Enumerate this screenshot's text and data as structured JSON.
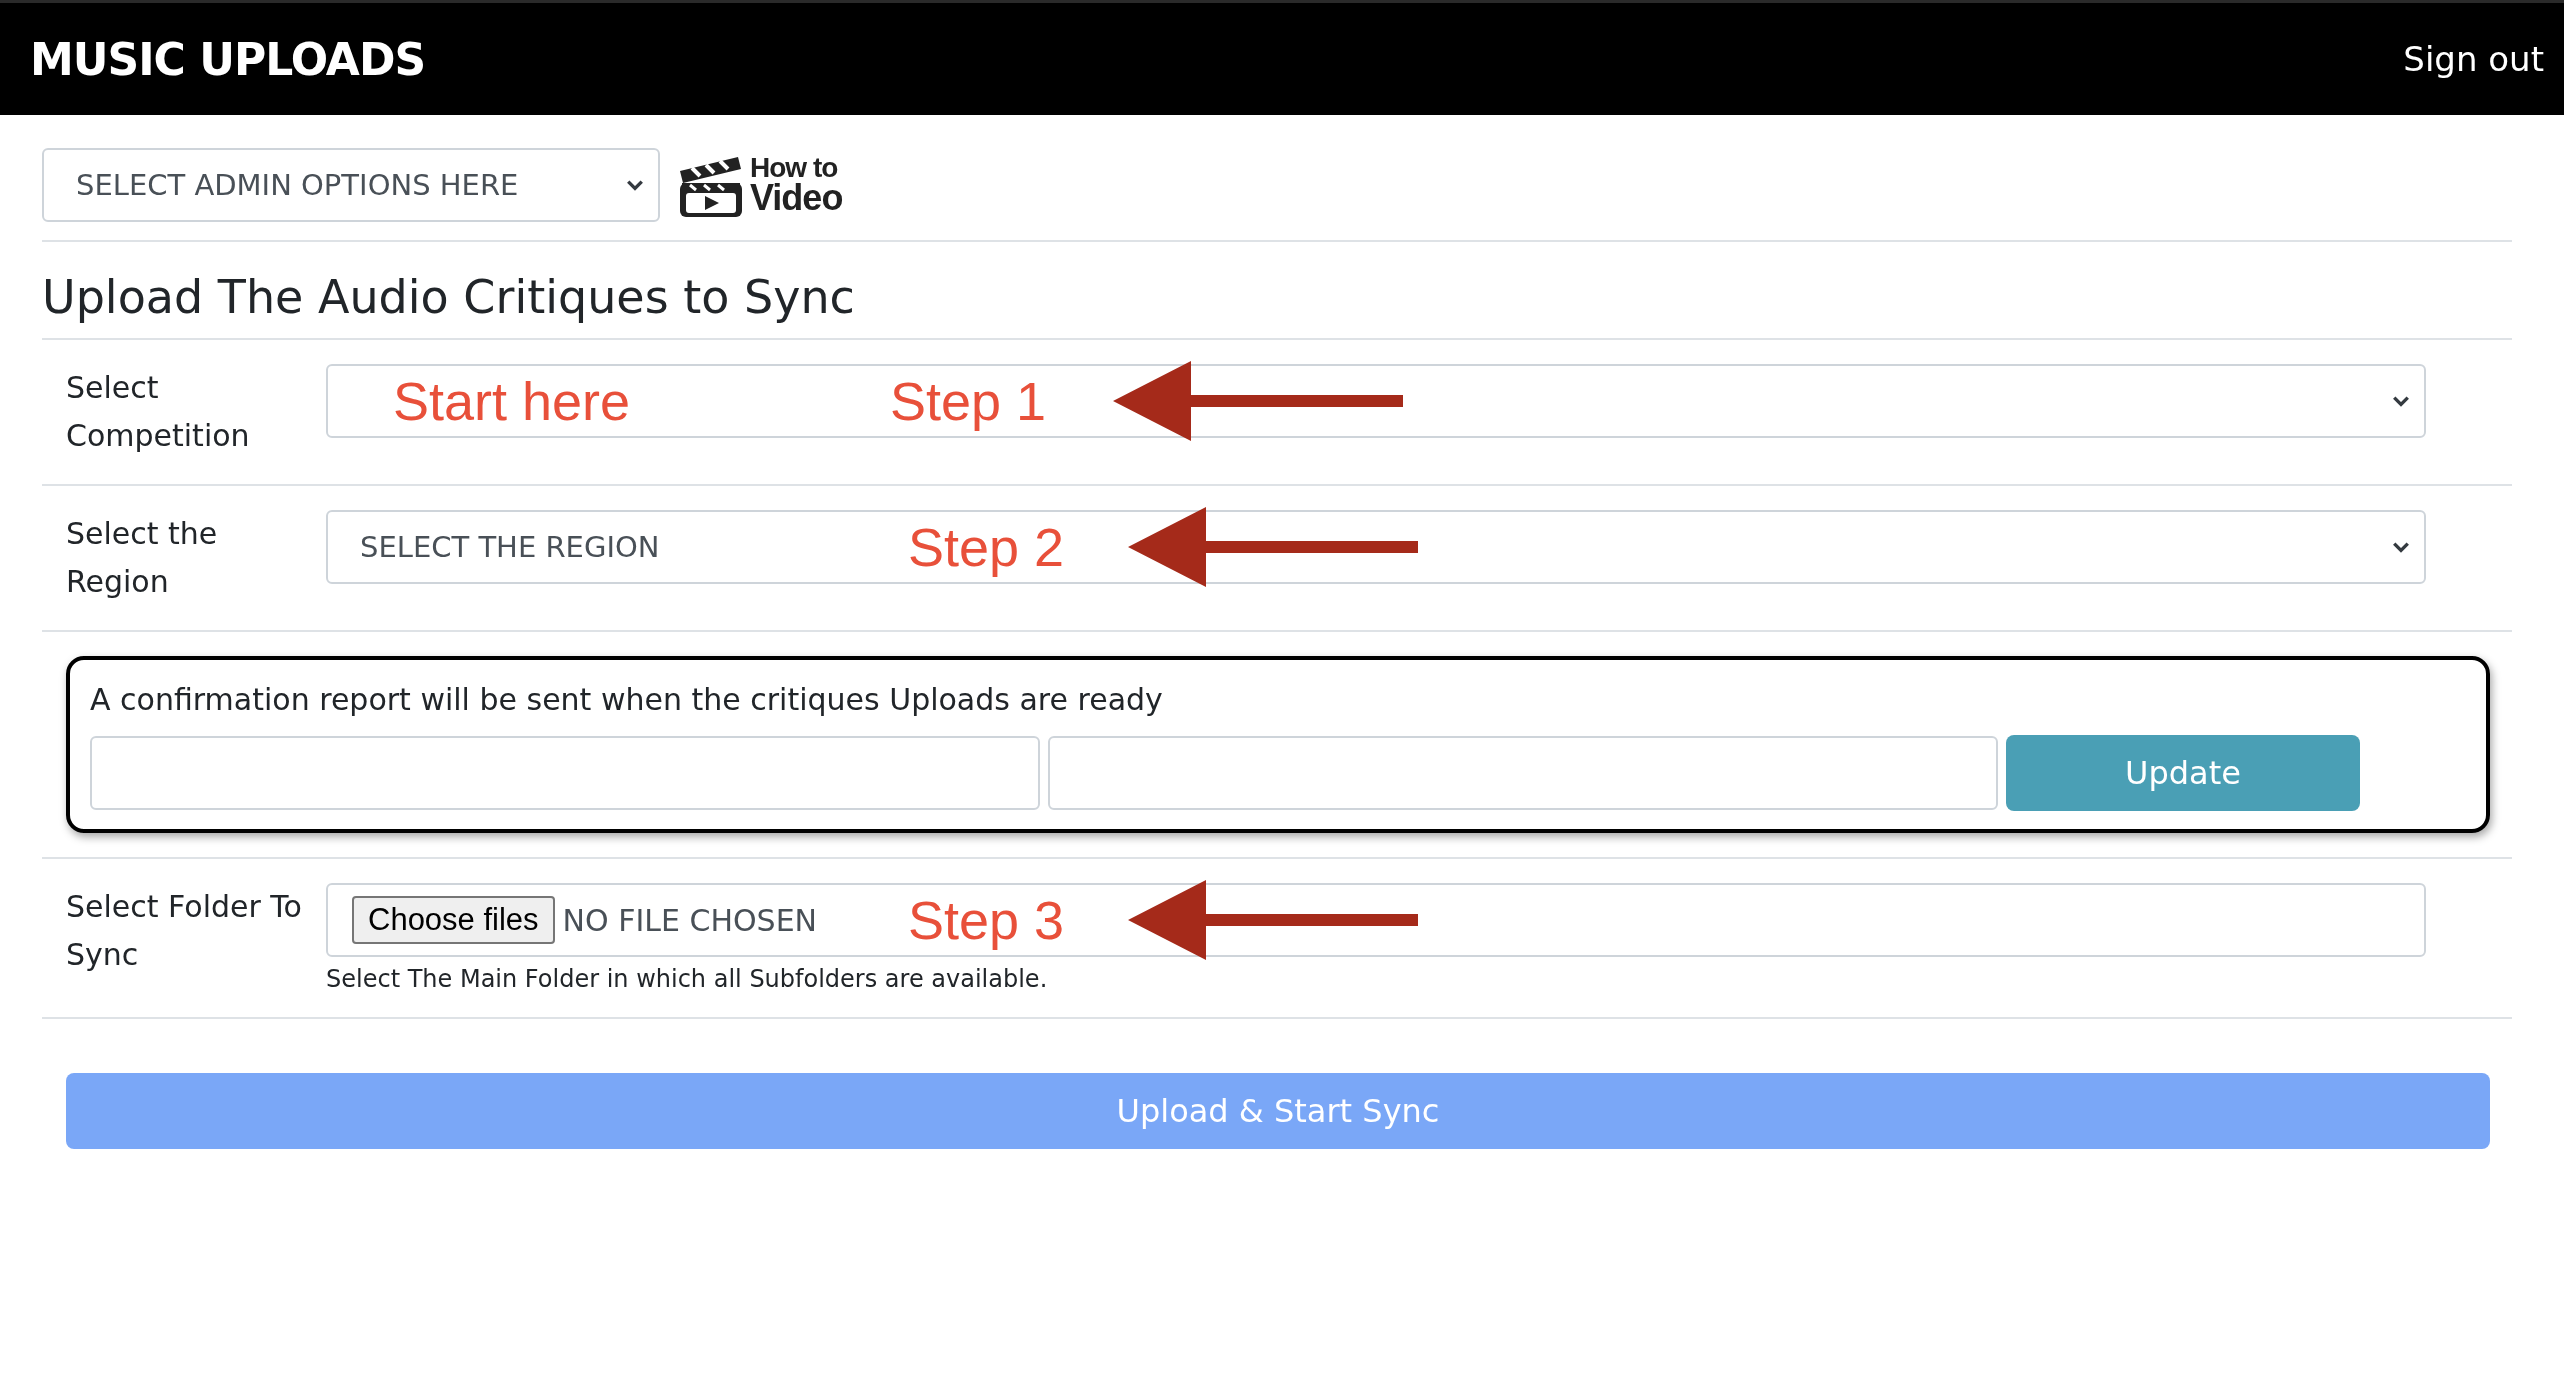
{
  "header": {
    "title": "MUSIC UPLOADS",
    "sign_out": "Sign out"
  },
  "admin_select": {
    "value": "SELECT ADMIN OPTIONS HERE"
  },
  "video_link": {
    "line_1": "How to",
    "line_2": "Video"
  },
  "heading": "Upload The Audio Critiques to Sync",
  "rows": [
    {
      "kind": "select",
      "label": "Select Competition",
      "annotations": [
        "Start here",
        "Step 1"
      ]
    },
    {
      "kind": "select",
      "label": "Select the Region",
      "value": "SELECT THE REGION",
      "annotations": [
        "Step 2"
      ]
    },
    {
      "kind": "confirm",
      "text": "A confirmation report will be sent when the critiques Uploads are ready",
      "button": "Update"
    },
    {
      "kind": "file",
      "label": "Select Folder To Sync",
      "button": "Choose files",
      "value": "NO FILE CHOSEN",
      "help": "Select The Main Folder in which all Subfolders are available.",
      "annotations": [
        "Step 3"
      ]
    }
  ],
  "submit": "Upload & Start Sync"
}
